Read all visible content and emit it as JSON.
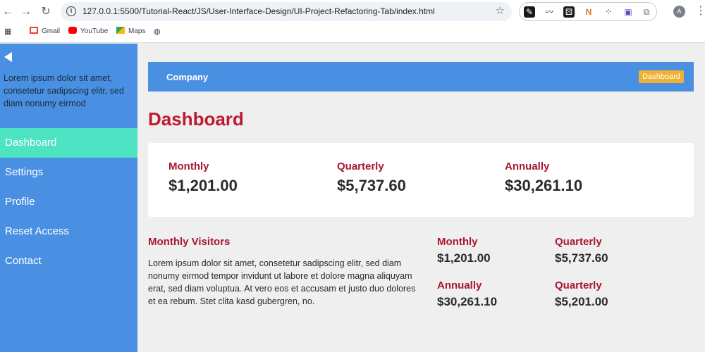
{
  "browser": {
    "url": "127.0.0.1:5500/Tutorial-React/JS/User-Interface-Design/UI-Project-Refactoring-Tab/index.html",
    "avatar_letter": "A",
    "bookmarks": [
      {
        "label": "Gmail",
        "icon": "gmail-icon",
        "color": "#ea4335"
      },
      {
        "label": "YouTube",
        "icon": "youtube-icon",
        "color": "#ff0000"
      },
      {
        "label": "Maps",
        "icon": "maps-icon",
        "color": "#34a853"
      }
    ]
  },
  "sidebar": {
    "blurb": "Lorem ipsum dolor sit amet, consetetur sadipscing elitr, sed diam nonumy eirmod",
    "items": [
      {
        "label": "Dashboard",
        "active": true
      },
      {
        "label": "Settings",
        "active": false
      },
      {
        "label": "Profile",
        "active": false
      },
      {
        "label": "Reset Access",
        "active": false
      },
      {
        "label": "Contact",
        "active": false
      }
    ]
  },
  "topbar": {
    "company": "Company",
    "badge": "Dashboard"
  },
  "page": {
    "title": "Dashboard"
  },
  "stats": [
    {
      "label": "Monthly",
      "value": "$1,201.00"
    },
    {
      "label": "Quarterly",
      "value": "$5,737.60"
    },
    {
      "label": "Annually",
      "value": "$30,261.10"
    }
  ],
  "visitors": {
    "title": "Monthly Visitors",
    "text": "Lorem ipsum dolor sit amet, consetetur sadipscing elitr, sed diam nonumy eirmod tempor invidunt ut labore et dolore magna aliquyam erat, sed diam voluptua. At vero eos et accusam et justo duo dolores et ea rebum. Stet clita kasd gubergren, no."
  },
  "mini_stats": [
    {
      "label": "Monthly",
      "value": "$1,201.00"
    },
    {
      "label": "Quarterly",
      "value": "$5,737.60"
    },
    {
      "label": "Annually",
      "value": "$30,261.10"
    },
    {
      "label": "Quarterly",
      "value": "$5,201.00"
    }
  ],
  "colors": {
    "sidebar": "#4a90e2",
    "active_item": "#4de3c3",
    "accent_text": "#c0182f",
    "badge": "#f0b030"
  }
}
